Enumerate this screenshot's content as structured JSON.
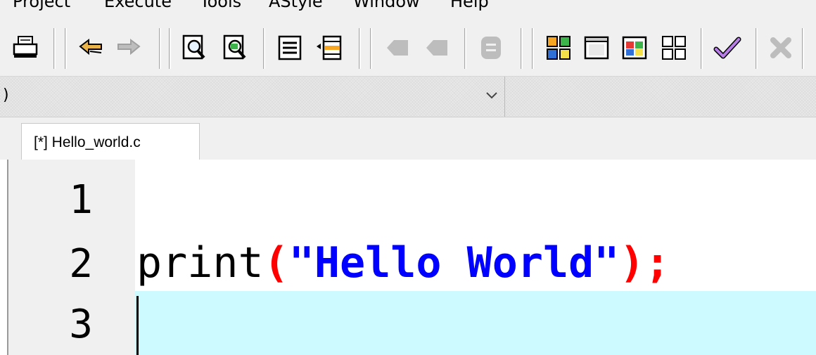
{
  "menu": {
    "items": [
      "Project",
      "Execute",
      "Tools",
      "AStyle",
      "Window",
      "Help"
    ]
  },
  "toolbar": {
    "buttons": [
      {
        "icon": "print-icon"
      },
      {
        "icon": "undo-icon"
      },
      {
        "icon": "redo-icon"
      },
      {
        "icon": "find-icon"
      },
      {
        "icon": "replace-icon"
      },
      {
        "icon": "indent-icon"
      },
      {
        "icon": "unindent-icon"
      },
      {
        "icon": "bookmark-toggle-icon"
      },
      {
        "icon": "bookmark-next-icon"
      },
      {
        "icon": "goto-line-icon"
      },
      {
        "icon": "new-project-icon"
      },
      {
        "icon": "open-project-icon"
      },
      {
        "icon": "project-options-icon"
      },
      {
        "icon": "class-browser-icon"
      },
      {
        "icon": "check-syntax-icon"
      },
      {
        "icon": "close-icon"
      }
    ],
    "accent_colors": {
      "orange": "#f6a623",
      "green": "#3cb44a",
      "blue": "#2f6fd6",
      "red": "#e53935",
      "purple": "#8e44ad"
    }
  },
  "combo": {
    "value": ")"
  },
  "tabs": [
    {
      "label": "[*] Hello_world.c",
      "active": true
    }
  ],
  "editor": {
    "line_numbers": [
      "1",
      "2",
      "3"
    ],
    "lines": {
      "line2": {
        "ident": "print",
        "open_paren": "(",
        "string": "\"Hello World\"",
        "close_paren": ")",
        "semicolon": ";"
      }
    },
    "colors": {
      "current_line": "#ccfafe",
      "string": "#0000ff",
      "symbol": "#ff0000",
      "gutter": "#f0f0f0"
    }
  }
}
